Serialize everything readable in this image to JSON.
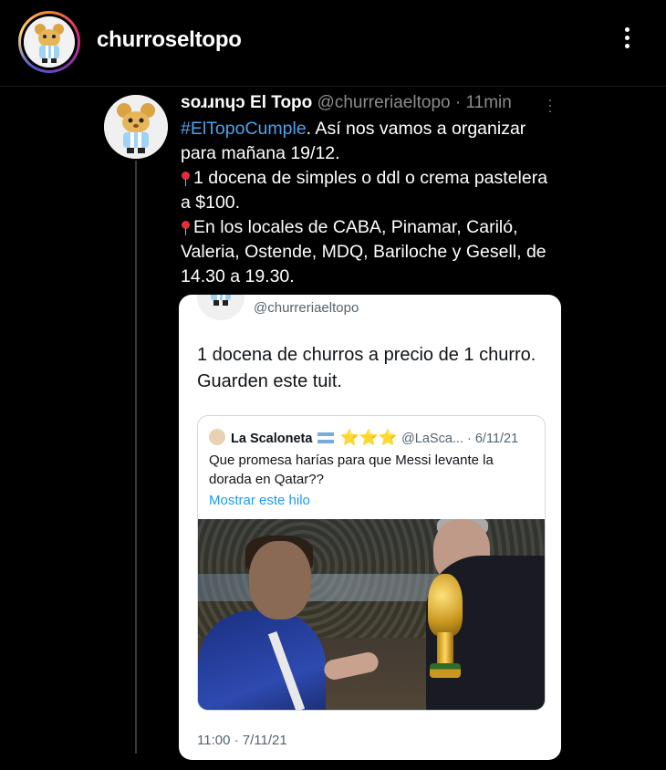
{
  "profile": {
    "username": "churroseltopo",
    "avatar_icon": "mascot-avatar",
    "more_icon": "vertical-dots-icon"
  },
  "tweet": {
    "display_name": "soɹɹnɥɔ El Topo",
    "handle": "@churreriaeltopo",
    "separator": "·",
    "time_ago": "11min",
    "hashtag": "#ElTopoCumple",
    "line1": ". Así nos vamos a organizar para mañana 19/12.",
    "line2": "1 docena de simples o ddl o crema pastelera a $100.",
    "line3": "En los locales de CABA, Pinamar, Cariló, Valeria, Ostende, MDQ, Bariloche y Gesell, de 14.30 a 19.30.",
    "pin_icon": "pushpin-icon",
    "accent_color": "#4ba3ec"
  },
  "embedded": {
    "handle": "@churreriaeltopo",
    "text": "1 docena de churros a precio de 1 churro. Guarden este tuit.",
    "timestamp": "11:00 · 7/11/21",
    "quoted": {
      "name": "La Scaloneta",
      "stars": "⭐⭐⭐",
      "handle_date": "@LaSca... · 6/11/21",
      "text": "Que promesa harías para que Messi levante la dorada en Qatar??",
      "show_thread": "Mostrar este hilo",
      "link_color": "#1d9bf0"
    }
  }
}
